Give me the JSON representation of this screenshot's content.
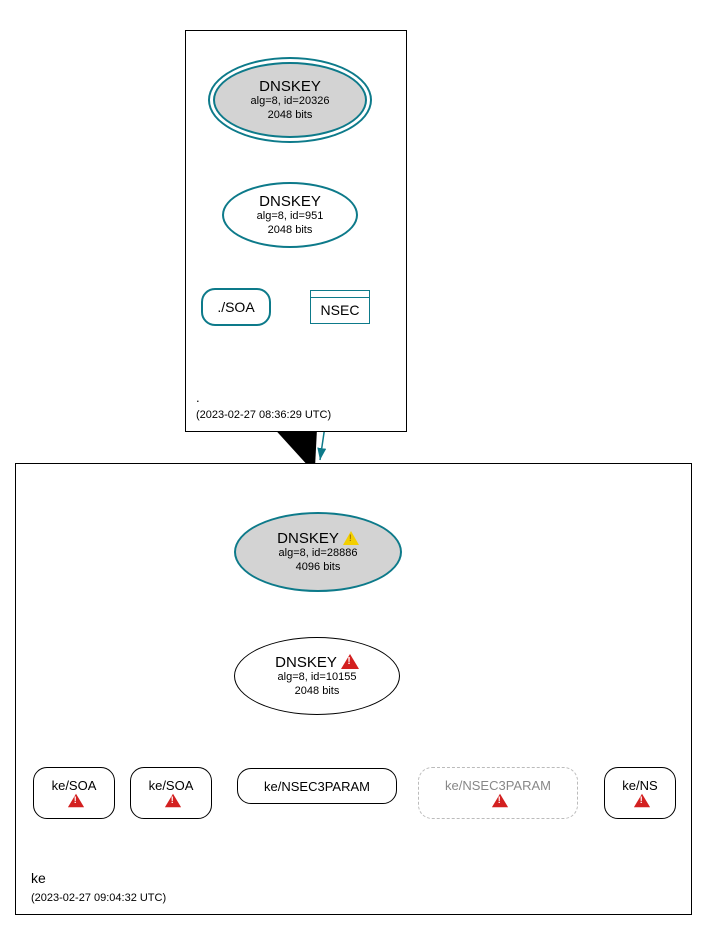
{
  "zone_root": {
    "name": ".",
    "timestamp": "(2023-02-27 08:36:29 UTC)",
    "ksk": {
      "title": "DNSKEY",
      "alg": "alg=8, id=20326",
      "bits": "2048 bits"
    },
    "zsk": {
      "title": "DNSKEY",
      "alg": "alg=8, id=951",
      "bits": "2048 bits"
    },
    "soa": "./SOA",
    "nsec": "NSEC"
  },
  "zone_ke": {
    "name": "ke",
    "timestamp": "(2023-02-27 09:04:32 UTC)",
    "ksk": {
      "title": "DNSKEY",
      "alg": "alg=8, id=28886",
      "bits": "4096 bits"
    },
    "zsk": {
      "title": "DNSKEY",
      "alg": "alg=8, id=10155",
      "bits": "2048 bits"
    },
    "leaves": {
      "soa1": "ke/SOA",
      "soa2": "ke/SOA",
      "n3p1": "ke/NSEC3PARAM",
      "n3p2": "ke/NSEC3PARAM",
      "ns": "ke/NS"
    }
  }
}
